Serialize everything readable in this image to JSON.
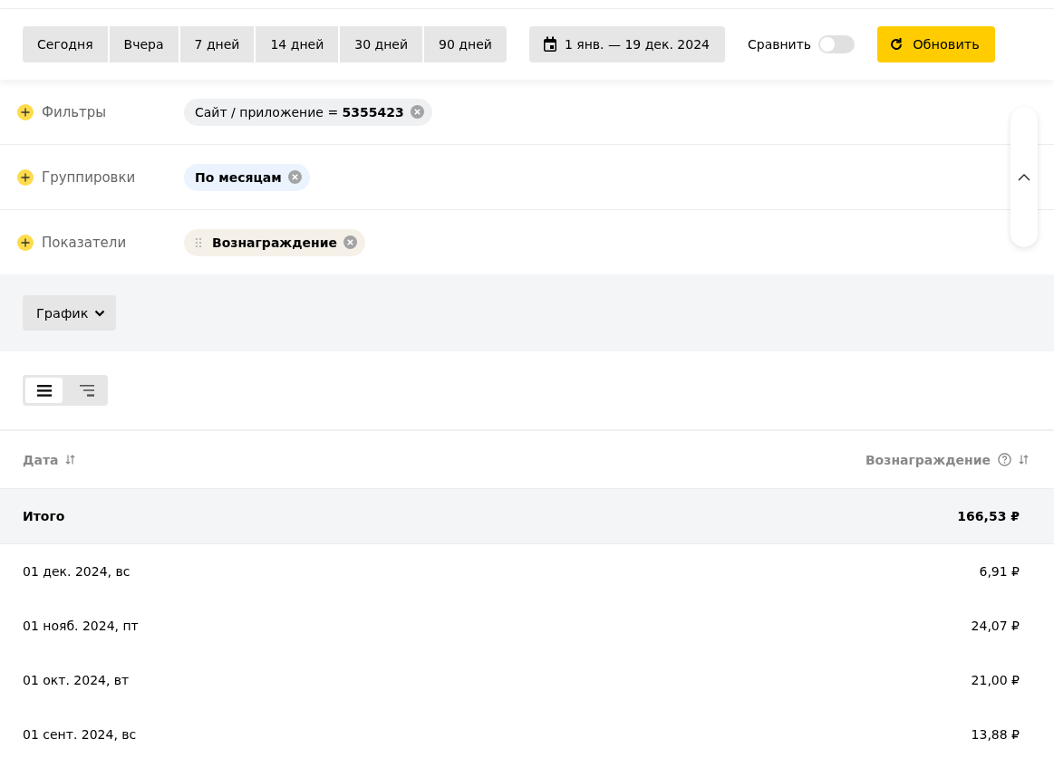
{
  "toolbar": {
    "periods": [
      {
        "label": "Сегодня"
      },
      {
        "label": "Вчера"
      },
      {
        "label": "7 дней"
      },
      {
        "label": "14 дней"
      },
      {
        "label": "30 дней"
      },
      {
        "label": "90 дней"
      }
    ],
    "date_range": "1 янв. — 19 дек. 2024",
    "compare": {
      "label": "Сравнить",
      "on": false
    },
    "refresh": "Обновить"
  },
  "settings": [
    {
      "kind": "filters",
      "label": "Фильтры",
      "chips": [
        {
          "text": "Сайт / приложение = **5355423**"
        }
      ]
    },
    {
      "kind": "groupings",
      "label": "Группировки",
      "chips": [
        {
          "text": "По месяцам"
        }
      ]
    },
    {
      "kind": "metrics",
      "label": "Показатели",
      "chips": [
        {
          "text": "Вознаграждение"
        }
      ]
    }
  ],
  "chart_button": "График",
  "view_modes": [
    {
      "kind": "table",
      "selected": true
    },
    {
      "kind": "tree",
      "selected": false
    }
  ],
  "table": {
    "columns": [
      {
        "label": "Дата",
        "help": false
      },
      {
        "label": "Вознаграждение",
        "help": true
      }
    ],
    "total": [
      "Итого",
      "166,53 ₽"
    ],
    "rows": [
      [
        "01 дек. 2024, вс",
        "6,91 ₽"
      ],
      [
        "01 нояб. 2024, пт",
        "24,07 ₽"
      ],
      [
        "01 окт. 2024, вт",
        "21,00 ₽"
      ],
      [
        "01 сент. 2024, вс",
        "13,88 ₽"
      ]
    ]
  }
}
